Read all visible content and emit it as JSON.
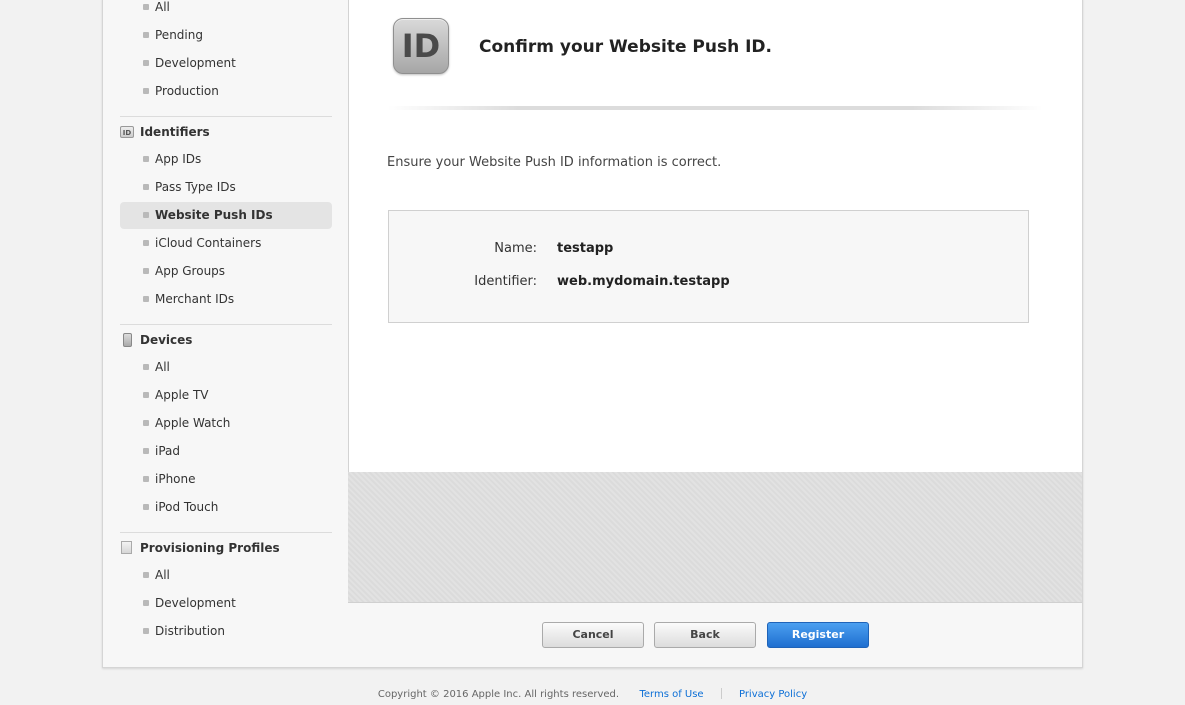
{
  "sidebar": {
    "certificates_items": [
      {
        "label": "All"
      },
      {
        "label": "Pending"
      },
      {
        "label": "Development"
      },
      {
        "label": "Production"
      }
    ],
    "identifiers": {
      "icon_text": "ID",
      "title": "Identifiers",
      "items": [
        {
          "label": "App IDs"
        },
        {
          "label": "Pass Type IDs"
        },
        {
          "label": "Website Push IDs"
        },
        {
          "label": "iCloud Containers"
        },
        {
          "label": "App Groups"
        },
        {
          "label": "Merchant IDs"
        }
      ]
    },
    "devices": {
      "title": "Devices",
      "items": [
        {
          "label": "All"
        },
        {
          "label": "Apple TV"
        },
        {
          "label": "Apple Watch"
        },
        {
          "label": "iPad"
        },
        {
          "label": "iPhone"
        },
        {
          "label": "iPod Touch"
        }
      ]
    },
    "profiles": {
      "title": "Provisioning Profiles",
      "items": [
        {
          "label": "All"
        },
        {
          "label": "Development"
        },
        {
          "label": "Distribution"
        }
      ]
    },
    "active_item": "Website Push IDs"
  },
  "main": {
    "icon_text": "ID",
    "title": "Confirm your Website Push ID.",
    "instruction": "Ensure your Website Push ID information is correct.",
    "fields": [
      {
        "label": "Name:",
        "value": "testapp"
      },
      {
        "label": "Identifier:",
        "value": "web.mydomain.testapp"
      }
    ]
  },
  "buttons": {
    "cancel": "Cancel",
    "back": "Back",
    "register": "Register"
  },
  "footer": {
    "copyright": "Copyright © 2016 Apple Inc. All rights reserved.",
    "terms": "Terms of Use",
    "privacy": "Privacy Policy"
  },
  "colors": {
    "primary_button": "#1f6fd0",
    "link": "#0c6fd6",
    "active_nav": "#e4e4e4"
  }
}
